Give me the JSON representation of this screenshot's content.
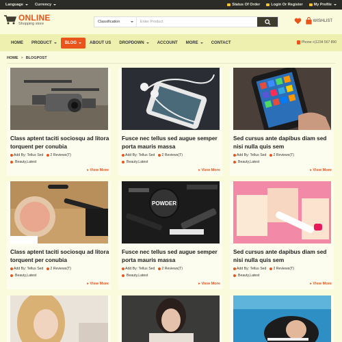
{
  "topbar": {
    "language": "Language",
    "currency": "Currency",
    "status": "Status Of Order",
    "login": "Login Or Register",
    "profile": "My Profile"
  },
  "header": {
    "logo_main": "ONLINE",
    "logo_sub": "Shopping store",
    "search_category": "Classification",
    "search_placeholder": "Enter Product",
    "wishlist": "WISHLIST"
  },
  "nav": {
    "items": [
      "HOME",
      "PRODUCT",
      "BLOG",
      "ABOUT US",
      "DROPDOWN",
      "ACCOUNT",
      "MORE",
      "CONTACT"
    ],
    "phone": "Phone:+(1234 567 890"
  },
  "breadcrumb": {
    "home": "HOME",
    "sep": ">",
    "current": "BLOGPOST"
  },
  "posts": [
    {
      "title": "Class aptent taciti sociosqu ad litora torquent per conubia",
      "author": "Add By: Tellus Sed",
      "reviews": "2 Reviews(T)",
      "tags": "Beauty,Latest",
      "more": "View More",
      "thumb": "drone"
    },
    {
      "title": "Fusce nec tellus sed augue semper porta mauris massa",
      "author": "Add By: Tellus Sed",
      "reviews": "2 Reviews(T)",
      "tags": "Beauty,Latest",
      "more": "View More",
      "thumb": "phone-earbuds"
    },
    {
      "title": "Sed cursus ante dapibus diam sed nisi nulla quis sem",
      "author": "Add By: Tellus Sed",
      "reviews": "2 Reviews(T)",
      "tags": "Beauty,Latest",
      "more": "View More",
      "thumb": "smartphone-apps"
    },
    {
      "title": "Class aptent taciti sociosqu ad litora torquent per conubia",
      "author": "Add By: Tellus Sed",
      "reviews": "2 Reviews(T)",
      "tags": "Beauty,Latest",
      "more": "View More",
      "thumb": "makeup-brushes"
    },
    {
      "title": "Fusce nec tellus sed augue semper porta mauris massa",
      "author": "Add By: Tellus Sed",
      "reviews": "2 Reviews(T)",
      "tags": "Beauty,Latest",
      "more": "View More",
      "thumb": "cosmetics-powder"
    },
    {
      "title": "Sed cursus ante dapibus diam sed nisi nulla quis sem",
      "author": "Add By: Tellus Sed",
      "reviews": "2 Reviews(T)",
      "tags": "Beauty,Latest",
      "more": "View More",
      "thumb": "pink-tubes"
    },
    {
      "title": "",
      "author": "",
      "reviews": "",
      "tags": "",
      "more": "",
      "thumb": "woman-blonde"
    },
    {
      "title": "",
      "author": "",
      "reviews": "",
      "tags": "",
      "more": "",
      "thumb": "woman-jacket"
    },
    {
      "title": "",
      "author": "",
      "reviews": "",
      "tags": "",
      "more": "",
      "thumb": "woman-pool"
    }
  ],
  "colors": {
    "accent": "#e8541b",
    "topbar": "#2b2b28",
    "nav": "#eef0b0",
    "background": "#fafbdc"
  }
}
